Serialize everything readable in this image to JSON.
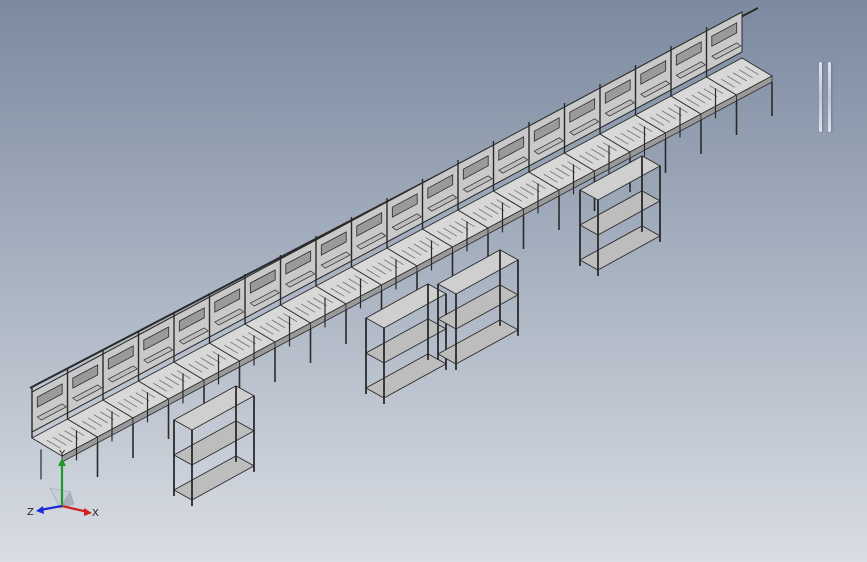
{
  "viewport": {
    "background_top": "#7b8aa0",
    "background_bottom": "#d9dde4",
    "model_edge_color": "#2a2a2a",
    "model_face_color": "#c9c9c9",
    "model_shade_color": "#9a9a9a",
    "conveyor_color": "#d8d8d8"
  },
  "model": {
    "description_icon": "assembly-line-model",
    "workstation_count": 20,
    "side_shelf_count": 4
  },
  "triad": {
    "x_label": "X",
    "y_label": "Y",
    "z_label": "Z",
    "x_color": "#d22020",
    "y_color": "#1f9a2a",
    "z_color": "#1c2bd6"
  }
}
